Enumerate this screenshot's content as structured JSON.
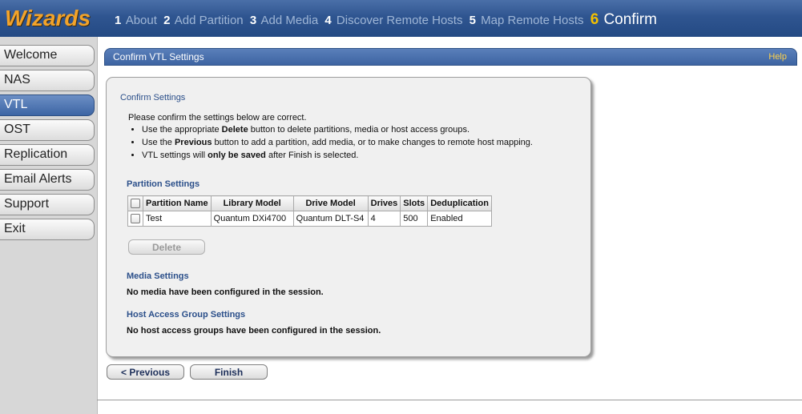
{
  "topbar": {
    "logo": "Wizards",
    "steps": [
      {
        "num": "1",
        "label": "About"
      },
      {
        "num": "2",
        "label": "Add Partition"
      },
      {
        "num": "3",
        "label": "Add Media"
      },
      {
        "num": "4",
        "label": "Discover Remote Hosts"
      },
      {
        "num": "5",
        "label": "Map Remote Hosts"
      },
      {
        "num": "6",
        "label": "Confirm"
      }
    ]
  },
  "sidebar": {
    "items": [
      {
        "label": "Welcome"
      },
      {
        "label": "NAS"
      },
      {
        "label": "VTL"
      },
      {
        "label": "OST"
      },
      {
        "label": "Replication"
      },
      {
        "label": "Email Alerts"
      },
      {
        "label": "Support"
      },
      {
        "label": "Exit"
      }
    ]
  },
  "header": {
    "title": "Confirm VTL Settings",
    "help": "Help"
  },
  "confirm": {
    "title": "Confirm Settings",
    "intro": "Please confirm the settings below are correct.",
    "bullet1": {
      "pre": "Use the appropriate ",
      "bold": "Delete",
      "post": " button to delete partitions, media or host access groups."
    },
    "bullet2": {
      "pre": "Use the ",
      "bold": "Previous",
      "post": " button to add a partition, add media, or to make changes to remote host mapping."
    },
    "bullet3": {
      "pre": "VTL settings will ",
      "bold": "only be saved",
      "post": " after Finish is selected."
    }
  },
  "partitions": {
    "title": "Partition Settings",
    "columns": {
      "name": "Partition Name",
      "library": "Library Model",
      "drive": "Drive Model",
      "drives": "Drives",
      "slots": "Slots",
      "dedup": "Deduplication"
    },
    "rows": [
      {
        "name": "Test",
        "library": "Quantum DXi4700",
        "drive": "Quantum DLT-S4",
        "drives": "4",
        "slots": "500",
        "dedup": "Enabled"
      }
    ],
    "delete_label": "Delete"
  },
  "media": {
    "title": "Media Settings",
    "message": "No media have been configured in the session."
  },
  "hostaccess": {
    "title": "Host Access Group Settings",
    "message": "No host access groups have been configured in the session."
  },
  "footer": {
    "previous_label": "< Previous",
    "finish_label": "Finish"
  },
  "colors": {
    "logo": "#f2a32a",
    "active_step": "#f4c000",
    "header_blue": "#3d64a2",
    "section_title": "#2b4f8a"
  }
}
